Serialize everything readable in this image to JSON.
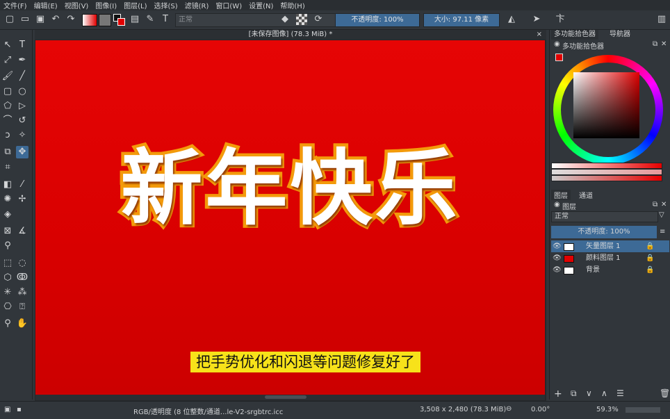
{
  "menubar": [
    "文件(F)",
    "编辑(E)",
    "视图(V)",
    "图像(I)",
    "图层(L)",
    "选择(S)",
    "滤镜(R)",
    "窗口(W)",
    "设置(N)",
    "帮助(H)"
  ],
  "toolbar": {
    "blend_mode": "正常",
    "opacity": "不透明度: 100%",
    "size": "大小: 97.11 像素"
  },
  "document": {
    "title": "[未保存图像]  (78.3 MiB)  *",
    "close": "×",
    "headline": "新年快乐",
    "subtitle": "把手势优化和闪退等问题修复好了"
  },
  "docker": {
    "tab_color": "多功能拾色器",
    "tab_navigator": "导航器",
    "panel_color_title": "多功能拾色器",
    "tab_layers": "图层",
    "tab_channels": "通道",
    "panel_layers_title": "图层",
    "layer_blend": "正常",
    "layer_opacity": "不透明度: 100%",
    "layers": [
      {
        "name": "矢量图层 1",
        "thumb": "#ffffff"
      },
      {
        "name": "颜料图层 1",
        "thumb": "#e00000"
      },
      {
        "name": "背景",
        "thumb": "#ffffff"
      }
    ]
  },
  "statusbar": {
    "color_profile": "RGB/透明度 (8 位整数/通道...le-V2-srgbtrc.icc",
    "image_size": "3,508 x 2,480 (78.3 MiB)",
    "rotation": "0.00°",
    "zoom": "59.3%"
  },
  "colors": {
    "accent": "#3d6a96",
    "canvas_red": "#e00000",
    "text_stroke": "#f39a0a",
    "subtitle_bg": "#f7e21a"
  }
}
